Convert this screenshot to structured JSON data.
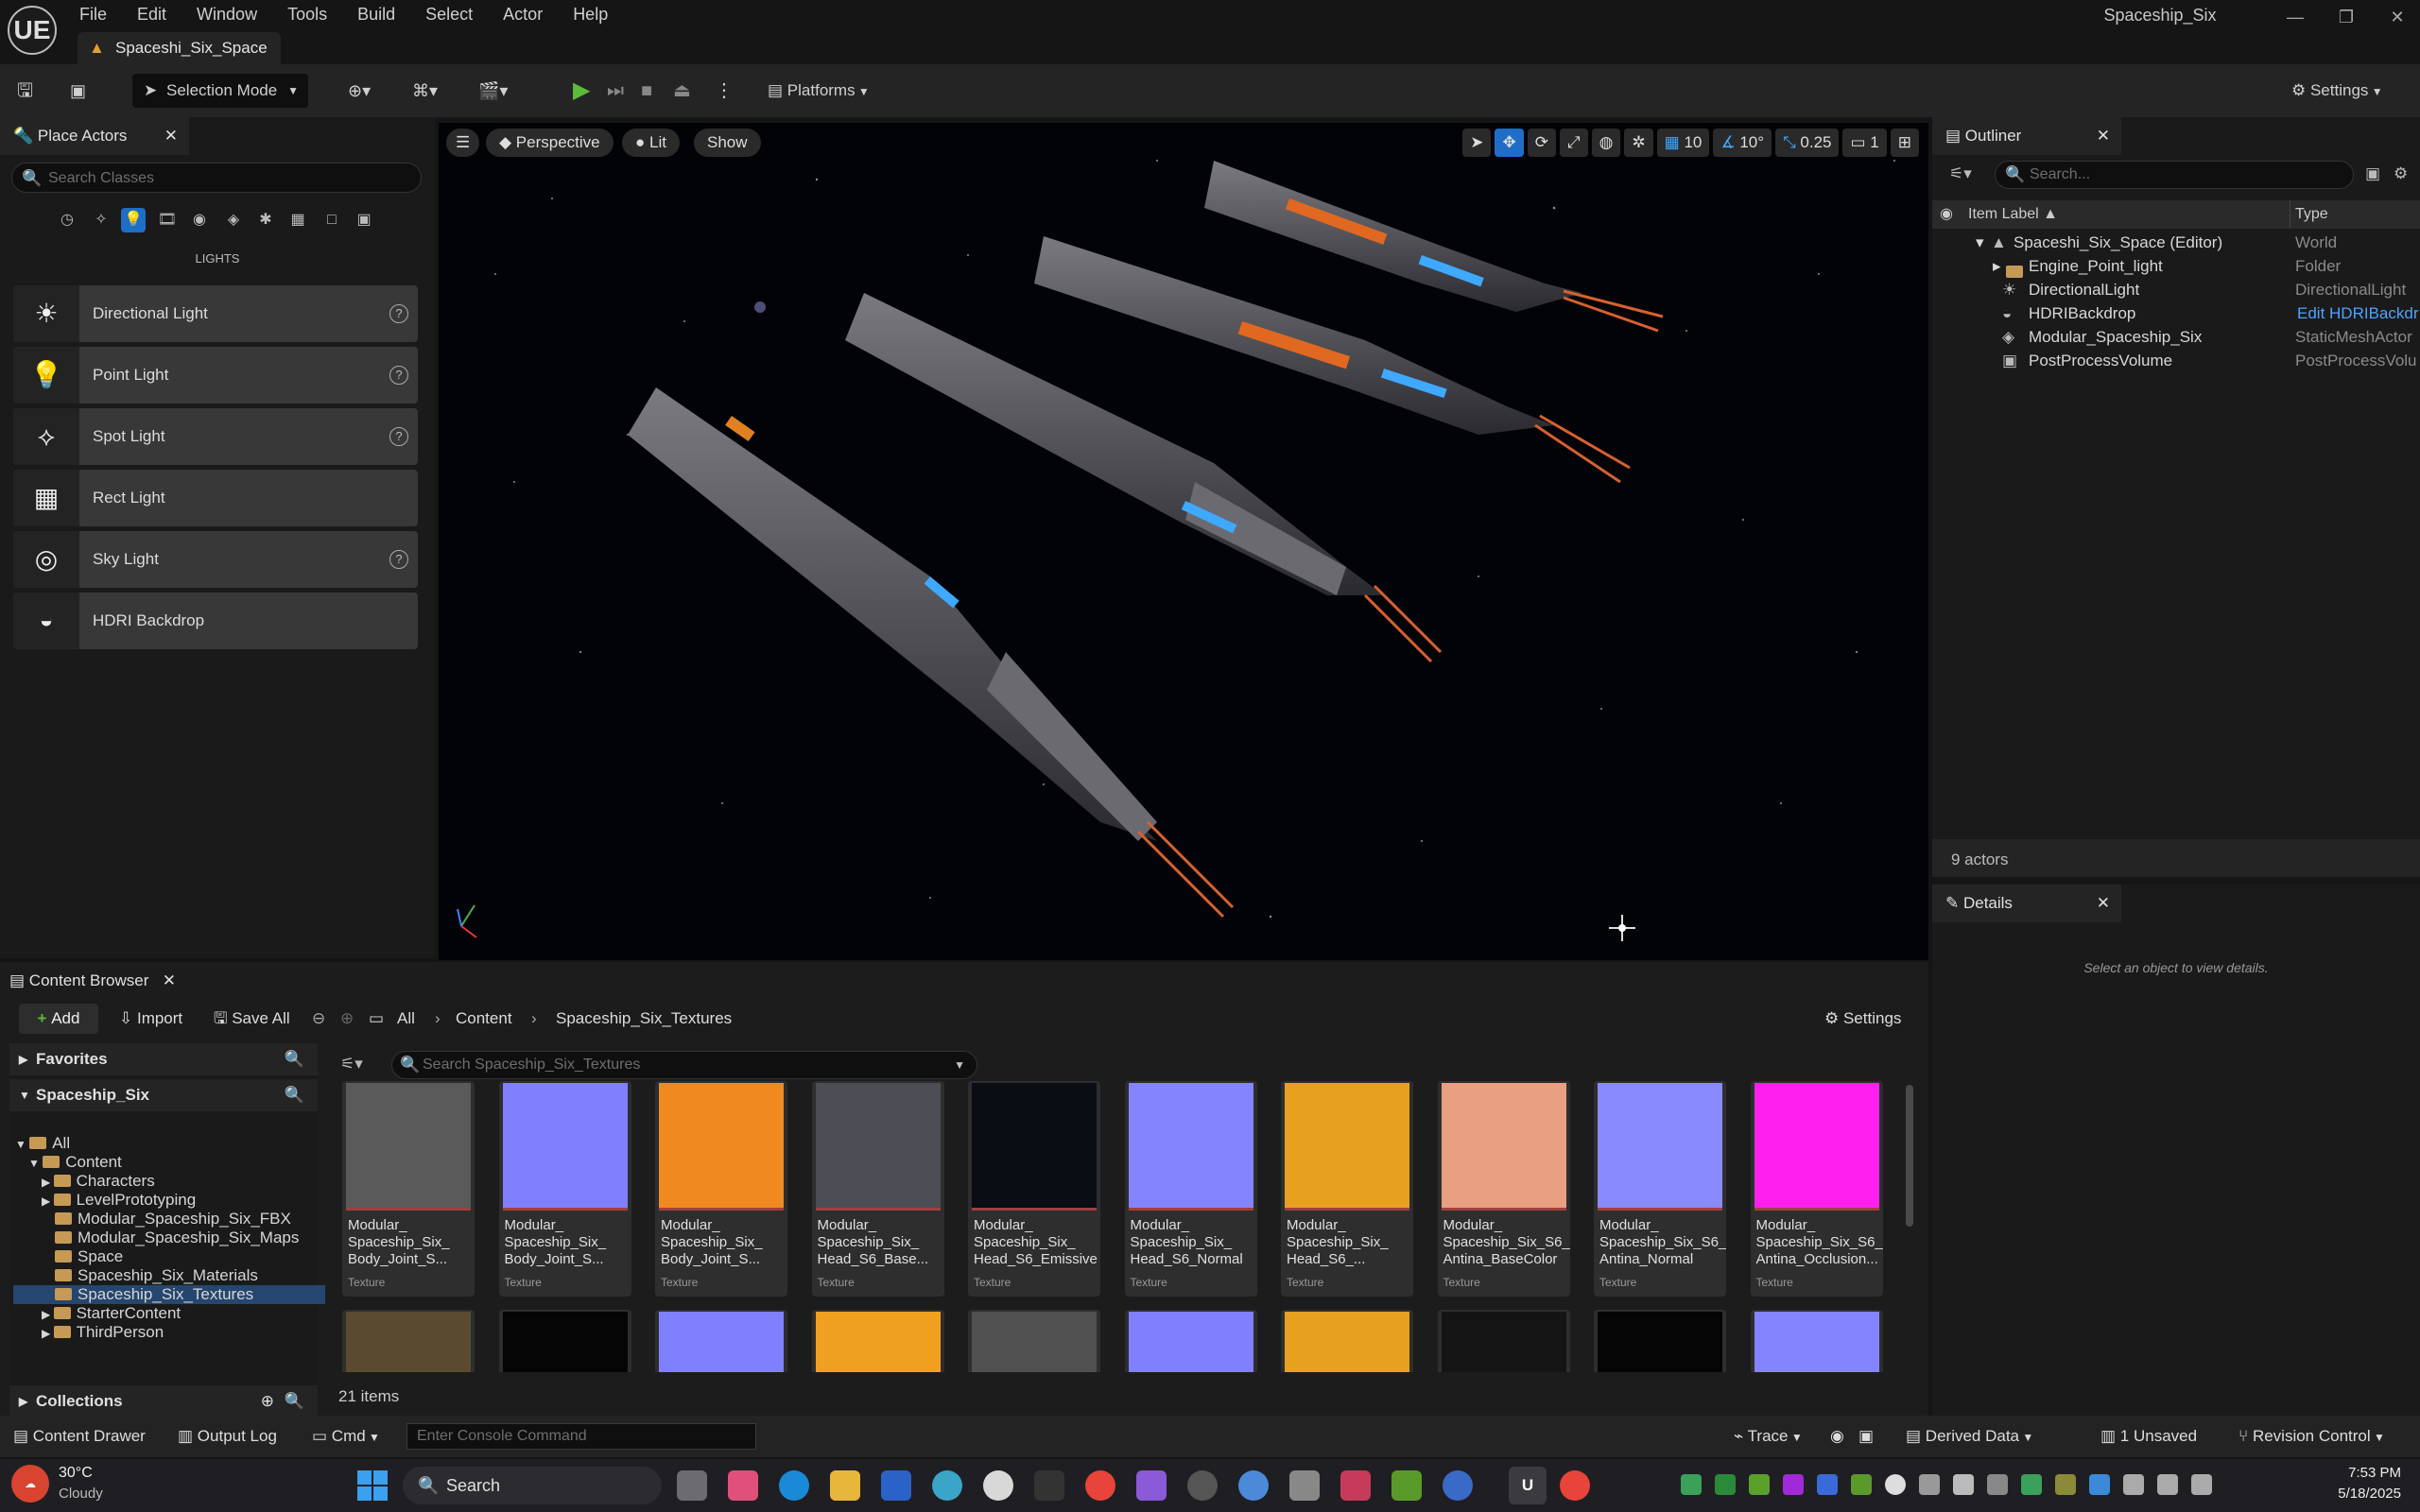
{
  "app": {
    "logo": "UE",
    "menu": [
      "File",
      "Edit",
      "Window",
      "Tools",
      "Build",
      "Select",
      "Actor",
      "Help"
    ],
    "level_tab": "Spaceshi_Six_Space",
    "project_name": "Spaceship_Six",
    "window_controls": [
      "—",
      "❐",
      "✕"
    ]
  },
  "toolbar": {
    "selection_mode": "Selection Mode",
    "platforms": "Platforms",
    "settings": "Settings"
  },
  "place_actors": {
    "tab": "Place Actors",
    "search_placeholder": "Search Classes",
    "category": "LIGHTS",
    "items": [
      {
        "label": "Directional Light",
        "icon": "directional-light-icon",
        "help": true
      },
      {
        "label": "Point Light",
        "icon": "point-light-icon",
        "help": true
      },
      {
        "label": "Spot Light",
        "icon": "spot-light-icon",
        "help": true
      },
      {
        "label": "Rect Light",
        "icon": "rect-light-icon",
        "help": false
      },
      {
        "label": "Sky Light",
        "icon": "sky-light-icon",
        "help": true
      },
      {
        "label": "HDRI Backdrop",
        "icon": "hdri-backdrop-icon",
        "help": false
      }
    ]
  },
  "viewport": {
    "perspective": "Perspective",
    "lit": "Lit",
    "show": "Show",
    "grid_snap": "10",
    "rotation_snap": "10°",
    "scale_snap": "0.25",
    "camera_speed": "1"
  },
  "outliner": {
    "tab": "Outliner",
    "search_placeholder": "Search...",
    "col_label": "Item Label ▲",
    "col_type": "Type",
    "rows": [
      {
        "label": "Spaceshi_Six_Space (Editor)",
        "type": "World"
      },
      {
        "label": "Engine_Point_light",
        "type": "Folder"
      },
      {
        "label": "DirectionalLight",
        "type": "DirectionalLight"
      },
      {
        "label": "HDRIBackdrop",
        "type": "Edit HDRIBackdr"
      },
      {
        "label": "Modular_Spaceship_Six",
        "type": "StaticMeshActor"
      },
      {
        "label": "PostProcessVolume",
        "type": "PostProcessVolu"
      }
    ],
    "actor_count": "9 actors"
  },
  "details": {
    "tab": "Details",
    "empty_text": "Select an object to view details."
  },
  "content_browser": {
    "tab": "Content Browser",
    "add": "Add",
    "import": "Import",
    "save_all": "Save All",
    "breadcrumb": [
      "All",
      "Content",
      "Spaceship_Six_Textures"
    ],
    "settings": "Settings",
    "favorites": "Favorites",
    "project": "Spaceship_Six",
    "tree": [
      {
        "label": "All",
        "depth": 0
      },
      {
        "label": "Content",
        "depth": 1
      },
      {
        "label": "Characters",
        "depth": 2
      },
      {
        "label": "LevelPrototyping",
        "depth": 2
      },
      {
        "label": "Modular_Spaceship_Six_FBX",
        "depth": 2
      },
      {
        "label": "Modular_Spaceship_Six_Maps",
        "depth": 2
      },
      {
        "label": "Space",
        "depth": 2
      },
      {
        "label": "Spaceship_Six_Materials",
        "depth": 2
      },
      {
        "label": "Spaceship_Six_Textures",
        "depth": 2
      },
      {
        "label": "StarterContent",
        "depth": 2
      },
      {
        "label": "ThirdPerson",
        "depth": 2
      }
    ],
    "collections": "Collections",
    "search_placeholder": "Search Spaceship_Six_Textures",
    "assets": [
      {
        "name": "Modular_\nSpaceship_Six_\nBody_Joint_S...",
        "type": "Texture",
        "color": "#5a5a5a"
      },
      {
        "name": "Modular_\nSpaceship_Six_\nBody_Joint_S...",
        "type": "Texture",
        "color": "#8080ff"
      },
      {
        "name": "Modular_\nSpaceship_Six_\nBody_Joint_S...",
        "type": "Texture",
        "color": "#f08a20"
      },
      {
        "name": "Modular_\nSpaceship_Six_\nHead_S6_Base...",
        "type": "Texture",
        "color": "#4d4d55"
      },
      {
        "name": "Modular_\nSpaceship_Six_\nHead_S6_Emissive",
        "type": "Texture",
        "color": "#0a0d14"
      },
      {
        "name": "Modular_\nSpaceship_Six_\nHead_S6_Normal",
        "type": "Texture",
        "color": "#8484ff"
      },
      {
        "name": "Modular_\nSpaceship_Six_\nHead_S6_...",
        "type": "Texture",
        "color": "#e8a020"
      },
      {
        "name": "Modular_\nSpaceship_Six_S6_\nAntina_BaseColor",
        "type": "Texture",
        "color": "#e8a080"
      },
      {
        "name": "Modular_\nSpaceship_Six_S6_\nAntina_Normal",
        "type": "Texture",
        "color": "#8a8aff"
      },
      {
        "name": "Modular_\nSpaceship_Six_S6_\nAntina_Occlusion...",
        "type": "Texture",
        "color": "#ff20f0"
      }
    ],
    "assets_row2_colors": [
      "#5a4a30",
      "#050505",
      "#8080ff",
      "#f0a020",
      "#505050",
      "#8080ff",
      "#e8a020",
      "#141414",
      "#050505",
      "#8484ff"
    ],
    "item_count": "21 items"
  },
  "statusbar": {
    "content_drawer": "Content Drawer",
    "output_log": "Output Log",
    "cmd": "Cmd",
    "console_placeholder": "Enter Console Command",
    "trace": "Trace",
    "derived_data": "Derived Data",
    "unsaved": "1 Unsaved",
    "revision_control": "Revision Control"
  },
  "taskbar": {
    "temperature": "30°C",
    "weather": "Cloudy",
    "search": "Search",
    "time": "7:53 PM",
    "date": "5/18/2025"
  }
}
